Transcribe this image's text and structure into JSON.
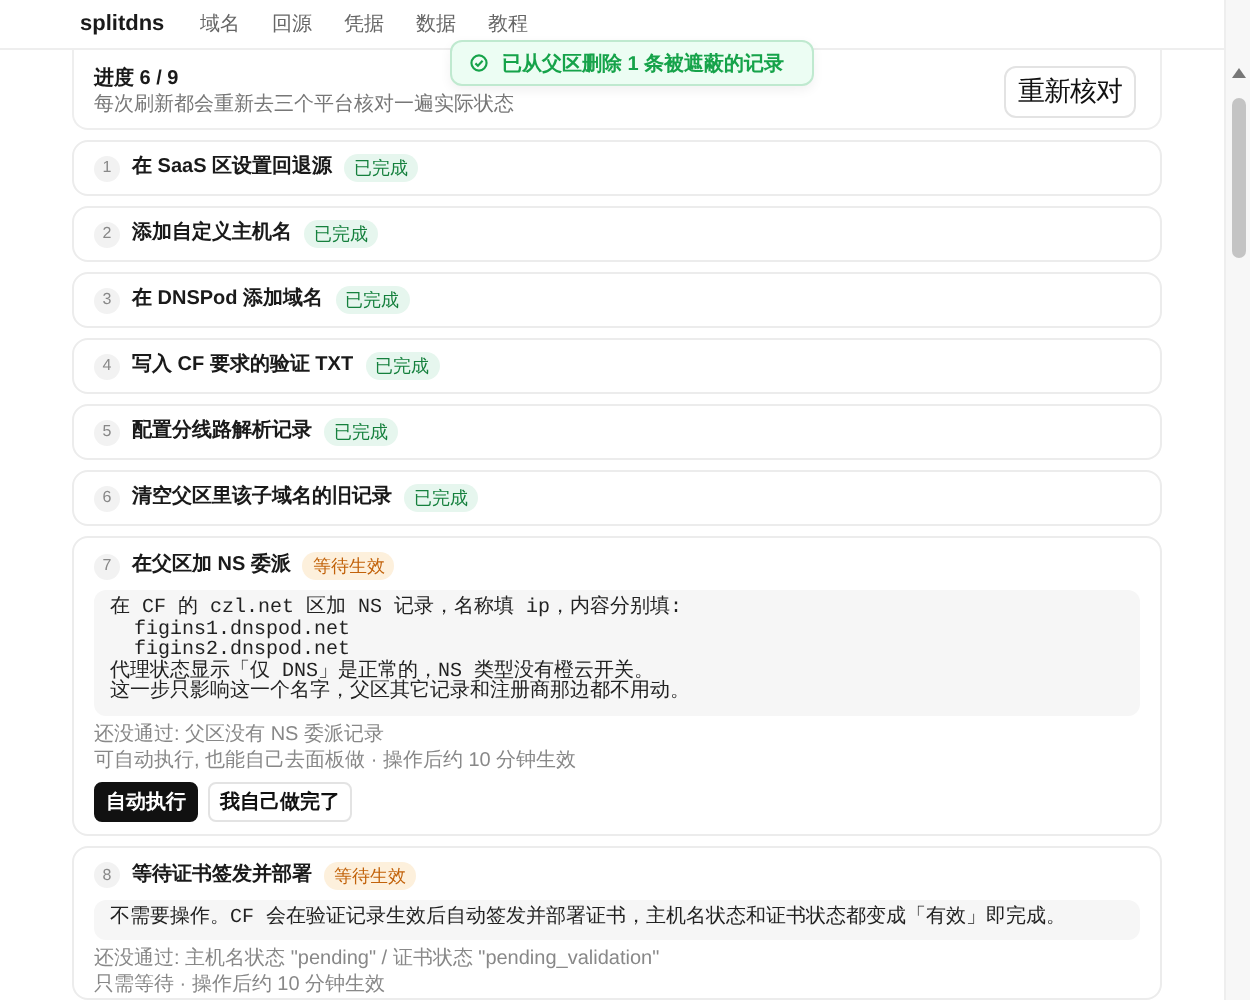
{
  "header": {
    "brand": "splitdns",
    "nav": [
      {
        "label": "域名",
        "selected": false
      },
      {
        "label": "回源",
        "selected": false
      },
      {
        "label": "凭据",
        "selected": false
      },
      {
        "label": "数据",
        "selected": false
      },
      {
        "label": "教程",
        "selected": false
      }
    ]
  },
  "toast": {
    "kind": "success",
    "message": "已从父区删除 1 条被遮蔽的记录"
  },
  "progress": {
    "title": "进度 6 / 9",
    "subtitle": "每次刷新都会重新去三个平台核对一遍实际状态",
    "button": "重新核对"
  },
  "steps": [
    {
      "number": "1",
      "title": "在 SaaS 区设置回退源",
      "status": {
        "kind": "done",
        "label": "已完成"
      }
    },
    {
      "number": "2",
      "title": "添加自定义主机名",
      "status": {
        "kind": "done",
        "label": "已完成"
      }
    },
    {
      "number": "3",
      "title": "在 DNSPod 添加域名",
      "status": {
        "kind": "done",
        "label": "已完成"
      }
    },
    {
      "number": "4",
      "title": "写入 CF 要求的验证 TXT",
      "status": {
        "kind": "done",
        "label": "已完成"
      }
    },
    {
      "number": "5",
      "title": "配置分线路解析记录",
      "status": {
        "kind": "done",
        "label": "已完成"
      }
    },
    {
      "number": "6",
      "title": "清空父区里该子域名的旧记录",
      "status": {
        "kind": "done",
        "label": "已完成"
      }
    },
    {
      "number": "7",
      "title": "在父区加 NS 委派",
      "status": {
        "kind": "waiting",
        "label": "等待生效"
      },
      "detail": [
        "在 CF 的 czl.net 区加 NS 记录，名称填 ip，内容分别填:",
        "  figins1.dnspod.net",
        "  figins2.dnspod.net",
        "代理状态显示「仅 DNS」是正常的，NS 类型没有橙云开关。",
        "这一步只影响这一个名字，父区其它记录和注册商那边都不用动。"
      ],
      "blocked": "还没通过: 父区没有 NS 委派记录",
      "meta": "可自动执行, 也能自己去面板做 · 操作后约 10 分钟生效",
      "buttons": [
        {
          "label": "自动执行",
          "kind": "primary"
        },
        {
          "label": "我自己做完了",
          "kind": "secondary"
        }
      ]
    },
    {
      "number": "8",
      "title": "等待证书签发并部署",
      "status": {
        "kind": "waiting",
        "label": "等待生效"
      },
      "detail": [
        "不需要操作。CF 会在验证记录生效后自动签发并部署证书，主机名状态和证书状态都变成「有效」即完成。"
      ],
      "blocked": "还没通过: 主机名状态 \"pending\" / 证书状态 \"pending_validation\"",
      "meta": "只需等待 · 操作后约 10 分钟生效"
    }
  ]
}
